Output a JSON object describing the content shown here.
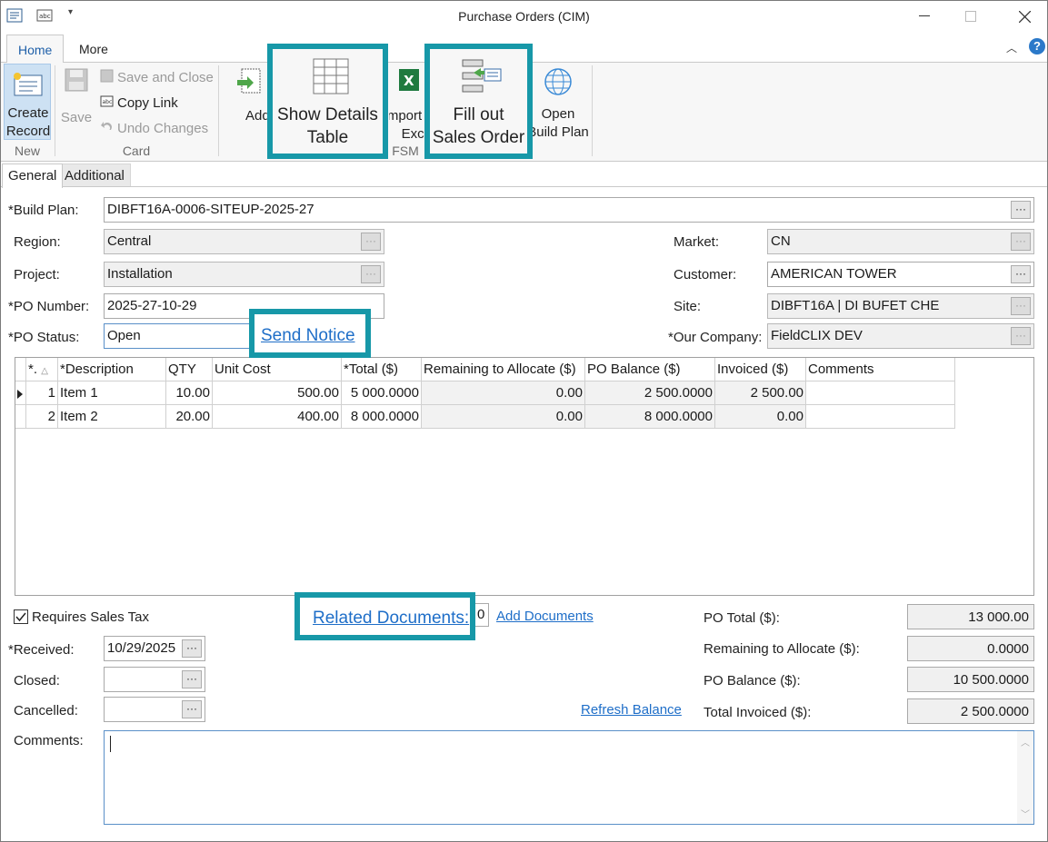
{
  "window": {
    "title": "Purchase Orders (CIM)"
  },
  "ribbon_tabs": [
    "Home",
    "More"
  ],
  "ribbon": {
    "new_group": {
      "create_label": "Create Record",
      "group_label": "New"
    },
    "card_group": {
      "save_label": "Save",
      "save_close_label": "Save and Close",
      "copy_link_label": "Copy Link",
      "undo_label": "Undo Changes",
      "group_label": "Card"
    },
    "fsm_group": {
      "add_docs_label": "Add Documents",
      "show_details_label": "Show Details Table",
      "import_label": "Import from Excel",
      "fill_sales_label": "Fill out Sales Order",
      "open_build_label": "Open Build Plan",
      "group_label": "FSM"
    }
  },
  "page_tabs": [
    "General",
    "Additional"
  ],
  "form": {
    "build_plan": {
      "label": "*Build Plan:",
      "value": "DIBFT16A-0006-SITEUP-2025-27"
    },
    "region": {
      "label": "Region:",
      "value": "Central"
    },
    "project": {
      "label": "Project:",
      "value": "Installation"
    },
    "po_number": {
      "label": "*PO Number:",
      "value": "2025-27-10-29"
    },
    "po_status": {
      "label": "*PO Status:",
      "value": "Open"
    },
    "send_notice": "Send Notice",
    "market": {
      "label": "Market:",
      "value": "CN"
    },
    "customer": {
      "label": "Customer:",
      "value": "AMERICAN TOWER"
    },
    "site": {
      "label": "Site:",
      "value": "DIBFT16A | DI BUFET CHE"
    },
    "our_company": {
      "label": "*Our Company:",
      "value": "FieldCLIX DEV"
    }
  },
  "grid": {
    "columns": [
      "*.",
      "*Description",
      "QTY",
      "Unit Cost",
      "*Total ($)",
      "Remaining to Allocate ($)",
      "PO Balance ($)",
      "Invoiced ($)",
      "Comments"
    ],
    "rows": [
      {
        "num": "1",
        "desc": "Item 1",
        "qty": "10.00",
        "unit": "500.00",
        "total": "5 000.0000",
        "remaining": "0.00",
        "balance": "2 500.0000",
        "invoiced": "2 500.00",
        "comments": ""
      },
      {
        "num": "2",
        "desc": "Item 2",
        "qty": "20.00",
        "unit": "400.00",
        "total": "8 000.0000",
        "remaining": "0.00",
        "balance": "8 000.0000",
        "invoiced": "0.00",
        "comments": ""
      }
    ]
  },
  "bottom": {
    "requires_tax": "Requires Sales Tax",
    "related_docs": "Related Documents:",
    "related_count": "0",
    "add_docs": "Add Documents",
    "received": {
      "label": "*Received:",
      "value": "10/29/2025"
    },
    "closed": {
      "label": "Closed:",
      "value": ""
    },
    "cancelled": {
      "label": "Cancelled:",
      "value": ""
    },
    "refresh": "Refresh Balance",
    "comments_label": "Comments:",
    "po_total": {
      "label": "PO Total ($):",
      "value": "13 000.00"
    },
    "remaining": {
      "label": "Remaining to Allocate ($):",
      "value": "0.0000"
    },
    "po_balance": {
      "label": "PO Balance ($):",
      "value": "10 500.0000"
    },
    "total_invoiced": {
      "label": "Total Invoiced ($):",
      "value": "2 500.0000"
    }
  },
  "colors": {
    "accent": "#1798a8",
    "link": "#1e6ec8",
    "tab_active": "#1e5fa8"
  }
}
